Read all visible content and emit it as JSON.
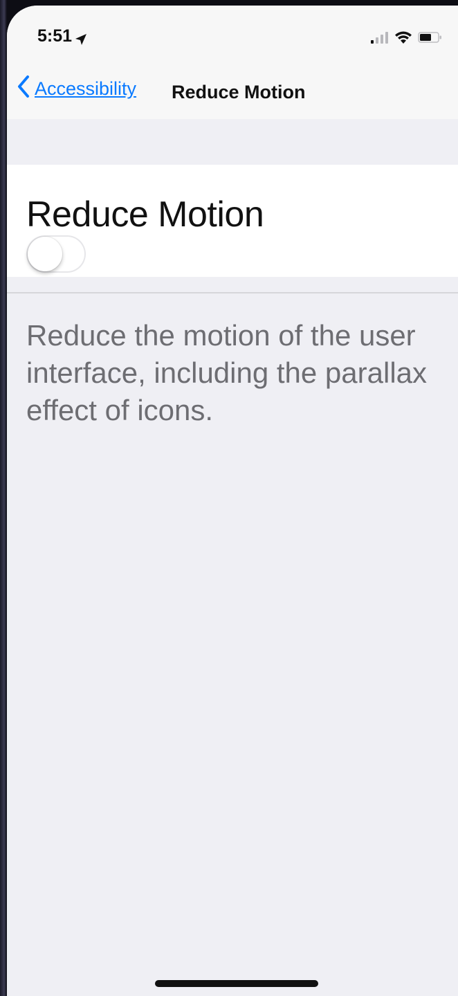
{
  "status_bar": {
    "time": "5:51",
    "icons": [
      "location-arrow-icon",
      "cellular-signal-icon",
      "wifi-icon",
      "battery-icon"
    ]
  },
  "nav": {
    "back_label": "Accessibility",
    "title": "Reduce Motion"
  },
  "setting": {
    "label": "Reduce Motion",
    "enabled": false
  },
  "footer": {
    "description": "Reduce the motion of the user interface, including the parallax effect of icons."
  },
  "colors": {
    "accent": "#0a7aff",
    "background": "#efeff4",
    "cell_background": "#ffffff",
    "secondary_text": "#6d6d72"
  }
}
